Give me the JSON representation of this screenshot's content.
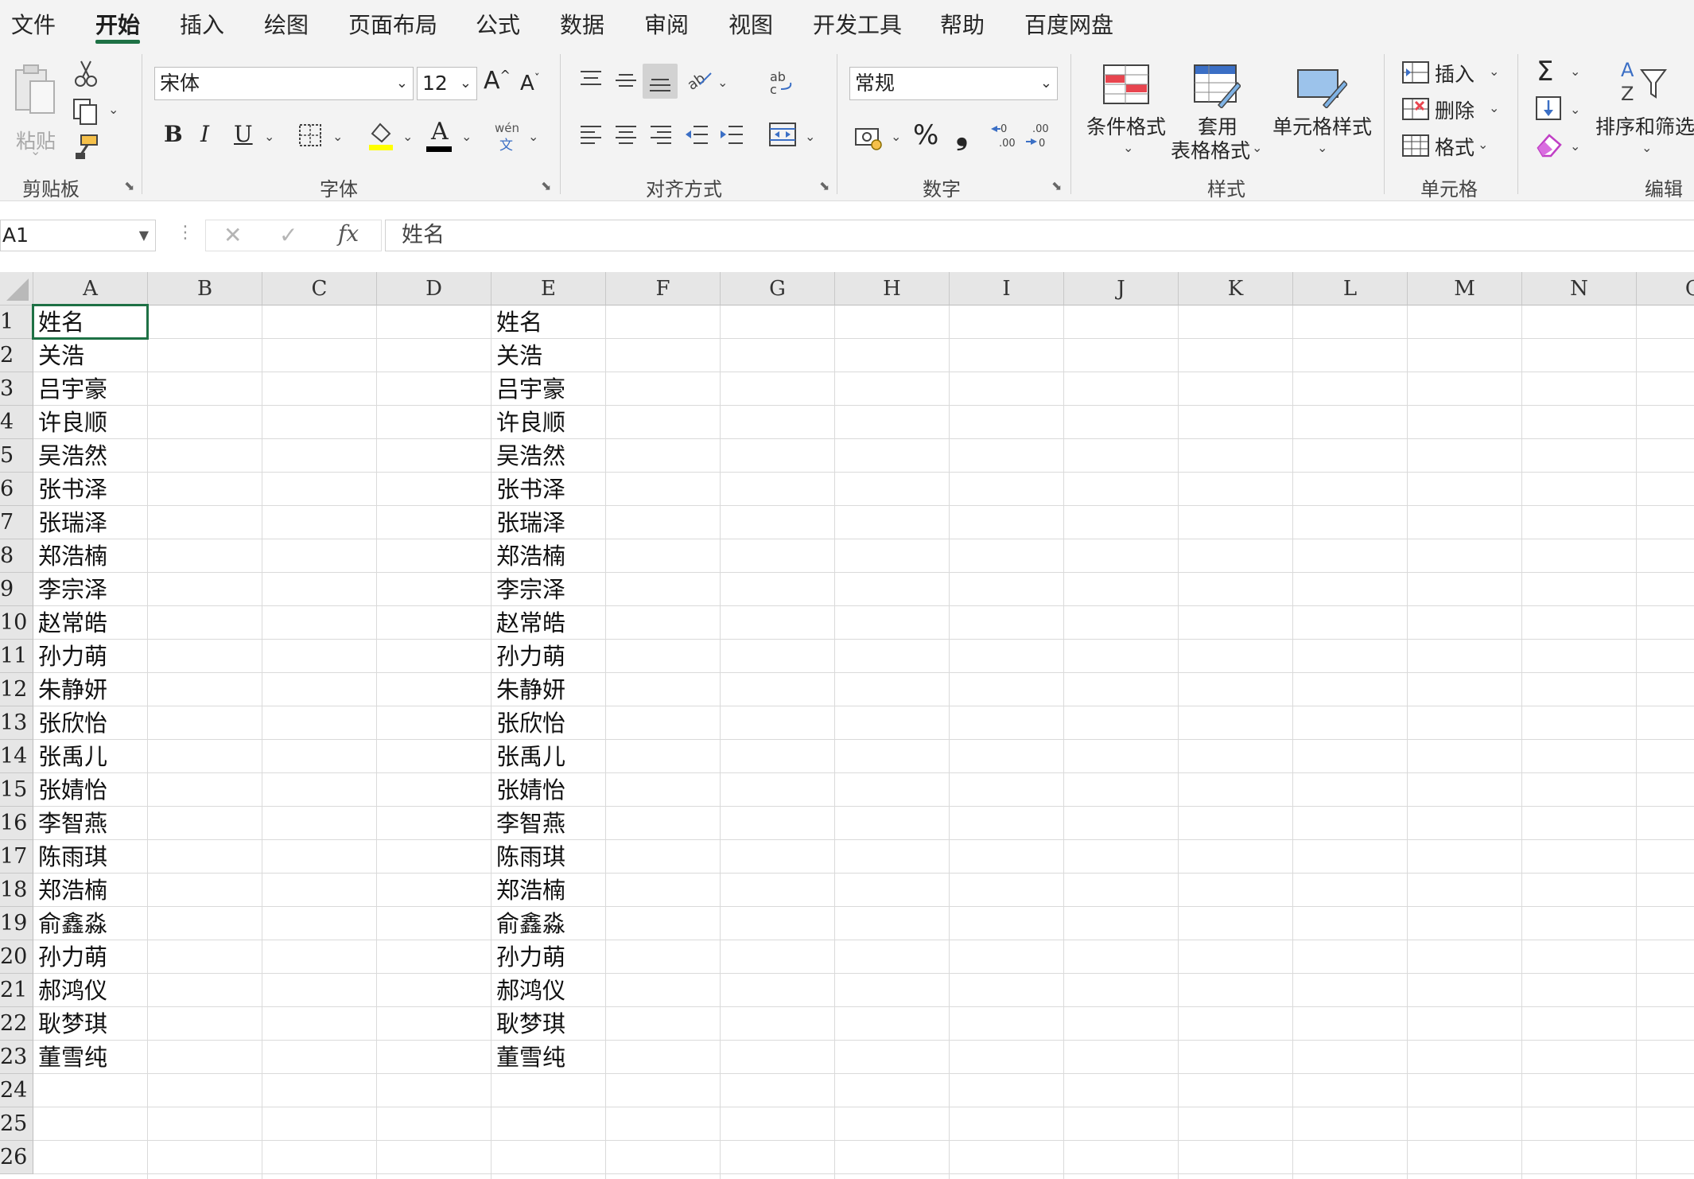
{
  "tabs": [
    "文件",
    "开始",
    "插入",
    "绘图",
    "页面布局",
    "公式",
    "数据",
    "审阅",
    "视图",
    "开发工具",
    "帮助",
    "百度网盘"
  ],
  "active_tab": "开始",
  "ribbon": {
    "clipboard": {
      "paste_label": "粘贴",
      "group_label": "剪贴板"
    },
    "font": {
      "font_name": "宋体",
      "font_size": "12",
      "phonetic_top": "wén",
      "phonetic_bottom": "文",
      "group_label": "字体"
    },
    "alignment": {
      "group_label": "对齐方式"
    },
    "number": {
      "format": "常规",
      "percent": "%",
      "comma": "❟",
      "group_label": "数字"
    },
    "styles": {
      "conditional": "条件格式",
      "table_line1": "套用",
      "table_line2": "表格格式",
      "cell_styles": "单元格样式",
      "group_label": "样式"
    },
    "cells": {
      "insert": "插入",
      "delete": "删除",
      "format": "格式",
      "group_label": "单元格"
    },
    "editing": {
      "sort_filter": "排序和筛选",
      "group_label": "编辑"
    }
  },
  "formula_bar": {
    "name_box": "A1",
    "fx": "fx",
    "content": "姓名"
  },
  "columns": [
    "A",
    "B",
    "C",
    "D",
    "E",
    "F",
    "G",
    "H",
    "I",
    "J",
    "K",
    "L",
    "M",
    "N",
    "O"
  ],
  "rows": [
    "1",
    "2",
    "3",
    "4",
    "5",
    "6",
    "7",
    "8",
    "9",
    "10",
    "11",
    "12",
    "13",
    "14",
    "15",
    "16",
    "17",
    "18",
    "19",
    "20",
    "21",
    "22",
    "23",
    "24",
    "25",
    "26"
  ],
  "sheet": {
    "colA": [
      "姓名",
      "关浩",
      "吕宇豪",
      "许良顺",
      "吴浩然",
      "张书泽",
      "张瑞泽",
      "郑浩楠",
      "李宗泽",
      "赵常皓",
      "孙力萌",
      "朱静妍",
      "张欣怡",
      "张禹儿",
      "张婧怡",
      "李智燕",
      "陈雨琪",
      "郑浩楠",
      "俞鑫淼",
      "孙力萌",
      "郝鸿仪",
      "耿梦琪",
      "董雪纯"
    ],
    "colE": [
      "姓名",
      "关浩",
      "吕宇豪",
      "许良顺",
      "吴浩然",
      "张书泽",
      "张瑞泽",
      "郑浩楠",
      "李宗泽",
      "赵常皓",
      "孙力萌",
      "朱静妍",
      "张欣怡",
      "张禹儿",
      "张婧怡",
      "李智燕",
      "陈雨琪",
      "郑浩楠",
      "俞鑫淼",
      "孙力萌",
      "郝鸿仪",
      "耿梦琪",
      "董雪纯"
    ]
  },
  "colors": {
    "accent": "#1e7145",
    "font_color_bar": "#000000",
    "fill_color_bar": "#ffff00"
  }
}
